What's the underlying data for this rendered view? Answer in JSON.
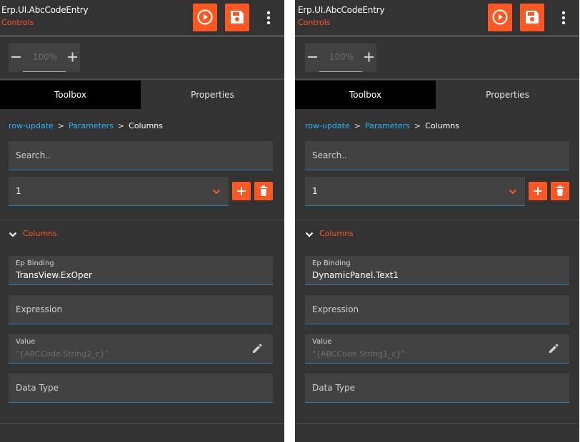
{
  "panels": [
    {
      "app_title": "Erp.UI.AbcCodeEntry",
      "app_subtitle": "Controls",
      "zoom": "100%",
      "tabs": [
        "Toolbox",
        "Properties"
      ],
      "breadcrumb": [
        "row-update",
        "Parameters",
        "Columns"
      ],
      "breadcrumb_sep": ">",
      "search_placeholder": "Search..",
      "selected_item": "1",
      "section": "Columns",
      "fields": {
        "ep_binding_label": "Ep Binding",
        "ep_binding_value": "TransView.ExOper",
        "expression_label": "Expression",
        "value_label": "Value",
        "value_value": "\"{ABCCode.String2_c}\"",
        "data_type_label": "Data Type"
      }
    },
    {
      "app_title": "Erp.UI.AbcCodeEntry",
      "app_subtitle": "Controls",
      "zoom": "100%",
      "tabs": [
        "Toolbox",
        "Properties"
      ],
      "breadcrumb": [
        "row-update",
        "Parameters",
        "Columns"
      ],
      "breadcrumb_sep": ">",
      "search_placeholder": "Search..",
      "selected_item": "1",
      "section": "Columns",
      "fields": {
        "ep_binding_label": "Ep Binding",
        "ep_binding_value": "DynamicPanel.Text1",
        "expression_label": "Expression",
        "value_label": "Value",
        "value_value": "\"{ABCCode.String1_c}\"",
        "data_type_label": "Data Type"
      }
    }
  ],
  "colors": {
    "accent": "#ff5722",
    "link": "#29b6f6",
    "panel_bg": "#333333",
    "field_bg": "#424242",
    "underline": "#2e7fb1"
  },
  "icons": [
    "play-circle-icon",
    "save-icon",
    "more-vert-icon",
    "minus-icon",
    "plus-icon",
    "chevron-down-icon",
    "add-icon",
    "delete-icon",
    "pencil-icon"
  ]
}
